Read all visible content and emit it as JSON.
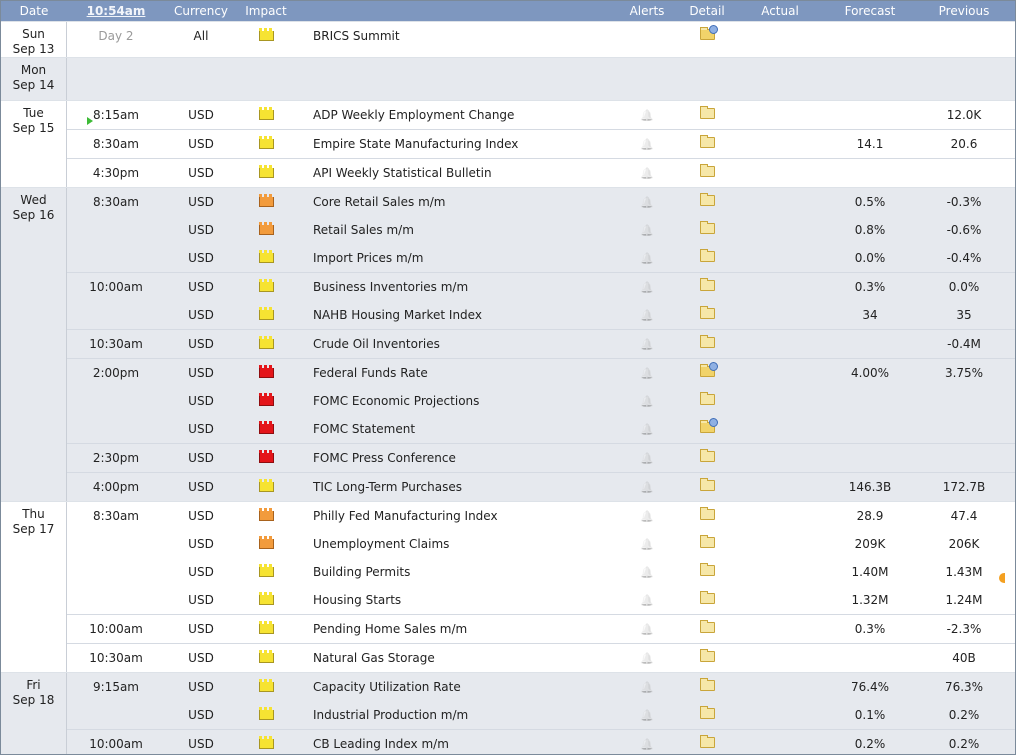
{
  "header": {
    "date": "Date",
    "time": "10:54am",
    "currency": "Currency",
    "impact": "Impact",
    "alerts": "Alerts",
    "detail": "Detail",
    "actual": "Actual",
    "forecast": "Forecast",
    "previous": "Previous"
  },
  "days": [
    {
      "dow": "Sun",
      "date": "Sep 13",
      "shaded": false,
      "rows": [
        {
          "time": "Day 2",
          "time_style": "day2",
          "currency": "All",
          "impact": "low",
          "event": "BRICS Summit",
          "alert": false,
          "detail": "link",
          "actual": "",
          "forecast": "",
          "previous": "",
          "new_time": true
        }
      ]
    },
    {
      "dow": "Mon",
      "date": "Sep 14",
      "shaded": true,
      "rows": []
    },
    {
      "dow": "Tue",
      "date": "Sep 15",
      "shaded": false,
      "rows": [
        {
          "time": "8:15am",
          "marker": "play",
          "currency": "USD",
          "impact": "low",
          "event": "ADP Weekly Employment Change",
          "alert": true,
          "detail": "folder",
          "actual": "",
          "forecast": "",
          "previous": "12.0K",
          "new_time": true
        },
        {
          "time": "8:30am",
          "currency": "USD",
          "impact": "low",
          "event": "Empire State Manufacturing Index",
          "alert": true,
          "detail": "folder",
          "actual": "",
          "forecast": "14.1",
          "previous": "20.6",
          "new_time": true
        },
        {
          "time": "4:30pm",
          "currency": "USD",
          "impact": "low",
          "event": "API Weekly Statistical Bulletin",
          "alert": true,
          "detail": "folder",
          "actual": "",
          "forecast": "",
          "previous": "",
          "new_time": true
        }
      ]
    },
    {
      "dow": "Wed",
      "date": "Sep 16",
      "shaded": true,
      "rows": [
        {
          "time": "8:30am",
          "currency": "USD",
          "impact": "med",
          "event": "Core Retail Sales m/m",
          "alert": true,
          "detail": "folder",
          "actual": "",
          "forecast": "0.5%",
          "previous": "-0.3%",
          "new_time": true
        },
        {
          "time": "",
          "currency": "USD",
          "impact": "med",
          "event": "Retail Sales m/m",
          "alert": true,
          "detail": "folder",
          "actual": "",
          "forecast": "0.8%",
          "previous": "-0.6%",
          "new_time": false
        },
        {
          "time": "",
          "currency": "USD",
          "impact": "low",
          "event": "Import Prices m/m",
          "alert": true,
          "detail": "folder",
          "actual": "",
          "forecast": "0.0%",
          "previous": "-0.4%",
          "new_time": false
        },
        {
          "time": "10:00am",
          "currency": "USD",
          "impact": "low",
          "event": "Business Inventories m/m",
          "alert": true,
          "detail": "folder",
          "actual": "",
          "forecast": "0.3%",
          "previous": "0.0%",
          "new_time": true
        },
        {
          "time": "",
          "currency": "USD",
          "impact": "low",
          "event": "NAHB Housing Market Index",
          "alert": true,
          "detail": "folder",
          "actual": "",
          "forecast": "34",
          "previous": "35",
          "new_time": false
        },
        {
          "time": "10:30am",
          "currency": "USD",
          "impact": "low",
          "event": "Crude Oil Inventories",
          "alert": true,
          "detail": "folder",
          "actual": "",
          "forecast": "",
          "previous": "-0.4M",
          "new_time": true
        },
        {
          "time": "2:00pm",
          "currency": "USD",
          "impact": "high",
          "event": "Federal Funds Rate",
          "alert": true,
          "detail": "link",
          "actual": "",
          "forecast": "4.00%",
          "previous": "3.75%",
          "new_time": true
        },
        {
          "time": "",
          "currency": "USD",
          "impact": "high",
          "event": "FOMC Economic Projections",
          "alert": true,
          "detail": "folder",
          "actual": "",
          "forecast": "",
          "previous": "",
          "new_time": false
        },
        {
          "time": "",
          "currency": "USD",
          "impact": "high",
          "event": "FOMC Statement",
          "alert": true,
          "detail": "link",
          "actual": "",
          "forecast": "",
          "previous": "",
          "new_time": false
        },
        {
          "time": "2:30pm",
          "currency": "USD",
          "impact": "high",
          "event": "FOMC Press Conference",
          "alert": true,
          "detail": "folder",
          "actual": "",
          "forecast": "",
          "previous": "",
          "new_time": true
        },
        {
          "time": "4:00pm",
          "currency": "USD",
          "impact": "low",
          "event": "TIC Long-Term Purchases",
          "alert": true,
          "detail": "folder",
          "actual": "",
          "forecast": "146.3B",
          "previous": "172.7B",
          "new_time": true
        }
      ]
    },
    {
      "dow": "Thu",
      "date": "Sep 17",
      "shaded": false,
      "rows": [
        {
          "time": "8:30am",
          "currency": "USD",
          "impact": "med",
          "event": "Philly Fed Manufacturing Index",
          "alert": true,
          "detail": "folder",
          "actual": "",
          "forecast": "28.9",
          "previous": "47.4",
          "new_time": true
        },
        {
          "time": "",
          "currency": "USD",
          "impact": "med",
          "event": "Unemployment Claims",
          "alert": true,
          "detail": "folder",
          "actual": "",
          "forecast": "209K",
          "previous": "206K",
          "new_time": false
        },
        {
          "time": "",
          "currency": "USD",
          "impact": "low",
          "event": "Building Permits",
          "alert": true,
          "detail": "folder",
          "actual": "",
          "forecast": "1.40M",
          "previous": "1.43M",
          "revised": true,
          "new_time": false
        },
        {
          "time": "",
          "currency": "USD",
          "impact": "low",
          "event": "Housing Starts",
          "alert": true,
          "detail": "folder",
          "actual": "",
          "forecast": "1.32M",
          "previous": "1.24M",
          "new_time": false
        },
        {
          "time": "10:00am",
          "currency": "USD",
          "impact": "low",
          "event": "Pending Home Sales m/m",
          "alert": true,
          "detail": "folder",
          "actual": "",
          "forecast": "0.3%",
          "previous": "-2.3%",
          "new_time": true
        },
        {
          "time": "10:30am",
          "currency": "USD",
          "impact": "low",
          "event": "Natural Gas Storage",
          "alert": true,
          "detail": "folder",
          "actual": "",
          "forecast": "",
          "previous": "40B",
          "new_time": true
        }
      ]
    },
    {
      "dow": "Fri",
      "date": "Sep 18",
      "shaded": true,
      "rows": [
        {
          "time": "9:15am",
          "currency": "USD",
          "impact": "low",
          "event": "Capacity Utilization Rate",
          "alert": true,
          "detail": "folder",
          "actual": "",
          "forecast": "76.4%",
          "previous": "76.3%",
          "new_time": true
        },
        {
          "time": "",
          "currency": "USD",
          "impact": "low",
          "event": "Industrial Production m/m",
          "alert": true,
          "detail": "folder",
          "actual": "",
          "forecast": "0.1%",
          "previous": "0.2%",
          "new_time": false
        },
        {
          "time": "10:00am",
          "currency": "USD",
          "impact": "low",
          "event": "CB Leading Index m/m",
          "alert": true,
          "detail": "folder",
          "actual": "",
          "forecast": "0.2%",
          "previous": "0.2%",
          "new_time": true
        }
      ]
    }
  ],
  "icons": {
    "impact_low": "impact-low-icon",
    "impact_med": "impact-medium-icon",
    "impact_high": "impact-high-icon",
    "detail": "folder-icon",
    "alert": "bell-icon"
  },
  "colors": {
    "header_bg": "#7e97bf",
    "shaded_row": "#e6e9ee",
    "impact_low": "#f6e332",
    "impact_medium": "#f29b3c",
    "impact_high": "#e4151a"
  }
}
